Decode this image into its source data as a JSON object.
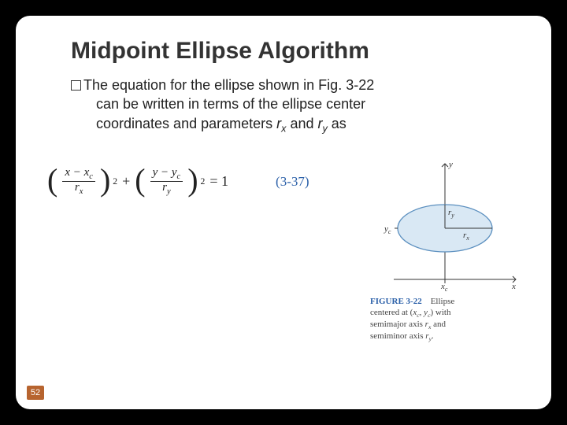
{
  "title": "Midpoint Ellipse Algorithm",
  "body": {
    "line1_part1": "The equation for the ellipse shown in Fig. 3-22",
    "line2": "can be written in terms of the ellipse center",
    "line3_part1": "coordinates and parameters ",
    "rx": "r",
    "rx_sub": "x",
    "and": " and ",
    "ry": "r",
    "ry_sub": "y",
    "line3_end": " as"
  },
  "equation": {
    "lparen1": "(",
    "num1": "x − x",
    "num1_sub": "c",
    "den1": "r",
    "den1_sub": "x",
    "rparen1": ")",
    "exp1": "2",
    "plus": " + ",
    "lparen2": "(",
    "num2": "y − y",
    "num2_sub": "c",
    "den2": "r",
    "den2_sub": "y",
    "rparen2": ")",
    "exp2": "2",
    "eq": " = 1",
    "number": "(3-37)"
  },
  "figure": {
    "ylabel": "y",
    "xlabel": "x",
    "yc": "y",
    "yc_sub": "c",
    "xc": "x",
    "xc_sub": "c",
    "ry": "r",
    "ry_sub": "y",
    "rx": "r",
    "rx_sub": "x",
    "caption_label": "FIGURE 3-22",
    "caption_text_1": "Ellipse",
    "caption_text_2": "centered at (",
    "caption_xc": "x",
    "caption_xc_sub": "c",
    "caption_comma": ", ",
    "caption_yc": "y",
    "caption_yc_sub": "c",
    "caption_text_3": ") with",
    "caption_text_4": "semimajor axis ",
    "caption_rx": "r",
    "caption_rx_sub": "x",
    "caption_text_5": " and",
    "caption_text_6": "semiminor axis ",
    "caption_ry": "r",
    "caption_ry_sub": "y",
    "caption_period": "."
  },
  "page": "52"
}
